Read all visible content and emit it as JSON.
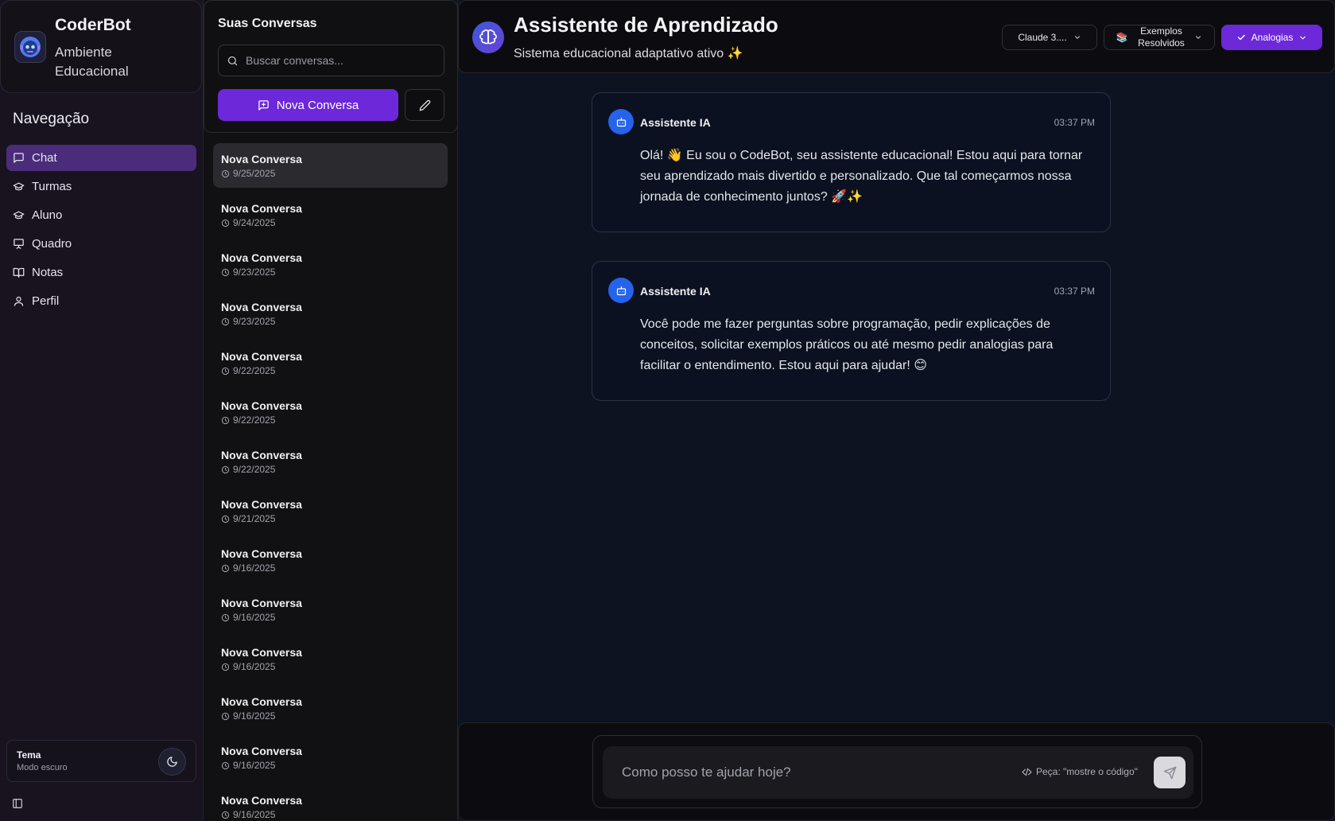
{
  "nav": {
    "brand_title": "CoderBot",
    "brand_subtitle": "Ambiente Educacional",
    "heading": "Navegação",
    "items": [
      {
        "label": "Chat",
        "icon": "message-square-icon",
        "active": true
      },
      {
        "label": "Turmas",
        "icon": "graduation-cap-icon",
        "active": false
      },
      {
        "label": "Aluno",
        "icon": "graduation-cap-icon",
        "active": false
      },
      {
        "label": "Quadro",
        "icon": "presentation-icon",
        "active": false
      },
      {
        "label": "Notas",
        "icon": "book-open-icon",
        "active": false
      },
      {
        "label": "Perfil",
        "icon": "user-icon",
        "active": false
      }
    ],
    "theme_title": "Tema",
    "theme_subtitle": "Modo escuro"
  },
  "conversations": {
    "title": "Suas Conversas",
    "search_placeholder": "Buscar conversas...",
    "new_button": "Nova Conversa",
    "items": [
      {
        "name": "Nova Conversa",
        "date": "9/25/2025"
      },
      {
        "name": "Nova Conversa",
        "date": "9/24/2025"
      },
      {
        "name": "Nova Conversa",
        "date": "9/23/2025"
      },
      {
        "name": "Nova Conversa",
        "date": "9/23/2025"
      },
      {
        "name": "Nova Conversa",
        "date": "9/22/2025"
      },
      {
        "name": "Nova Conversa",
        "date": "9/22/2025"
      },
      {
        "name": "Nova Conversa",
        "date": "9/22/2025"
      },
      {
        "name": "Nova Conversa",
        "date": "9/21/2025"
      },
      {
        "name": "Nova Conversa",
        "date": "9/16/2025"
      },
      {
        "name": "Nova Conversa",
        "date": "9/16/2025"
      },
      {
        "name": "Nova Conversa",
        "date": "9/16/2025"
      },
      {
        "name": "Nova Conversa",
        "date": "9/16/2025"
      },
      {
        "name": "Nova Conversa",
        "date": "9/16/2025"
      },
      {
        "name": "Nova Conversa",
        "date": "9/16/2025"
      }
    ]
  },
  "header": {
    "title": "Assistente de Aprendizado",
    "subtitle": "Sistema educacional adaptativo ativo ✨",
    "model_label": "Claude 3....",
    "examples_label": "Exemplos Resolvidos",
    "analogies_label": "Analogias"
  },
  "messages": [
    {
      "author": "Assistente IA",
      "time": "03:37 PM",
      "text": "Olá! 👋 Eu sou o CodeBot, seu assistente educacional! Estou aqui para tornar seu aprendizado mais divertido e personalizado. Que tal começarmos nossa jornada de conhecimento juntos? 🚀✨"
    },
    {
      "author": "Assistente IA",
      "time": "03:37 PM",
      "text": "Você pode me fazer perguntas sobre programação, pedir explicações de conceitos, solicitar exemplos práticos ou até mesmo pedir analogias para facilitar o entendimento. Estou aqui para ajudar! 😊"
    }
  ],
  "composer": {
    "placeholder": "Como posso te ajudar hoje?",
    "hint": "Peça: \"mostre o código\""
  },
  "colors": {
    "accent": "#6d28d9",
    "active_nav": "#4a2c7a",
    "avatar_blue": "#2563eb"
  }
}
